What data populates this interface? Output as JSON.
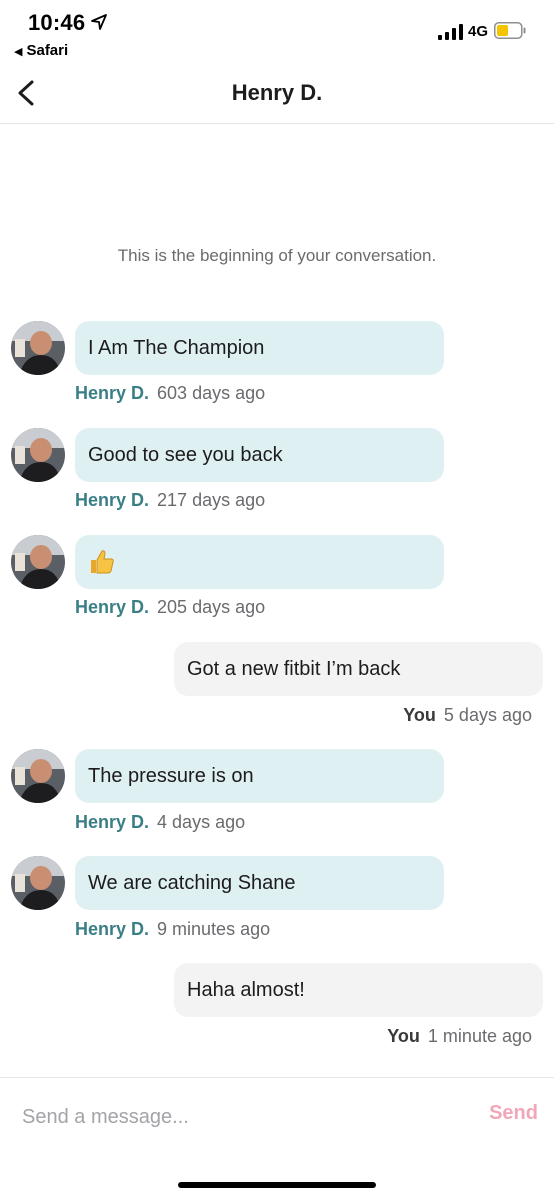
{
  "status_bar": {
    "time": "10:46",
    "back_app": "Safari",
    "network": "4G",
    "battery_color": "#f5c400",
    "icons": [
      "location-arrow-icon",
      "signal-icon",
      "battery-icon"
    ]
  },
  "header": {
    "title": "Henry D.",
    "back_icon": "chevron-left-icon"
  },
  "conversation": {
    "beginning_text": "This is the beginning of your conversation."
  },
  "messages": [
    {
      "direction": "incoming",
      "text": "I Am The Champion",
      "sender": "Henry D.",
      "time": "603 days ago"
    },
    {
      "direction": "incoming",
      "text": "Good to see you back",
      "sender": "Henry D.",
      "time": "217 days ago"
    },
    {
      "direction": "incoming",
      "text": "",
      "emoji": "thumbs-up-icon",
      "sender": "Henry D.",
      "time": "205 days ago"
    },
    {
      "direction": "outgoing",
      "text": "Got a new fitbit I’m back",
      "sender": "You",
      "time": "5 days ago"
    },
    {
      "direction": "incoming",
      "text": "The pressure is on",
      "sender": "Henry D.",
      "time": "4 days ago"
    },
    {
      "direction": "incoming",
      "text": "We are catching Shane",
      "sender": "Henry D.",
      "time": "9 minutes ago"
    },
    {
      "direction": "outgoing",
      "text": "Haha almost!",
      "sender": "You",
      "time": "1 minute ago"
    }
  ],
  "composer": {
    "placeholder": "Send a message...",
    "send_label": "Send",
    "send_color": "#f2a7b8"
  },
  "colors": {
    "incoming_bubble": "#dff0f2",
    "outgoing_bubble": "#f3f3f4",
    "sender_name": "#3b7f86"
  }
}
